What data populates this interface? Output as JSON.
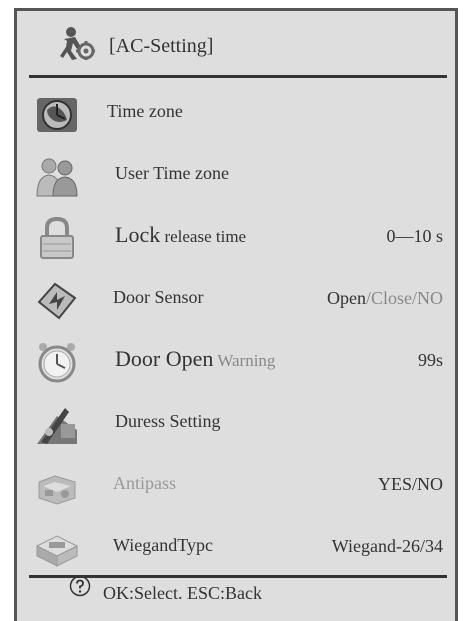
{
  "header": {
    "title": "[AC-Setting]",
    "icon": "user-settings-icon"
  },
  "menu": {
    "items": [
      {
        "label": "Time zone",
        "value": "",
        "icon": "clock-globe-icon"
      },
      {
        "label": "User Time zone",
        "value": "",
        "icon": "users-icon"
      },
      {
        "label_main": "Lock",
        "label_rest": " release time",
        "value": "0—10 s",
        "icon": "lock-icon"
      },
      {
        "label": "Door Sensor",
        "value_a": "Open",
        "value_b": "/Close/NO",
        "icon": "door-sensor-icon"
      },
      {
        "label_main": "Door Open",
        "label_rest": " Warning",
        "value": "99s",
        "icon": "alarm-clock-icon"
      },
      {
        "label": "Duress Setting",
        "value": "",
        "icon": "duress-icon"
      },
      {
        "label": "Antipass",
        "value": "YES/NO",
        "icon": "antipass-icon"
      },
      {
        "label": "WiegandTypc",
        "value": "Wiegand-26/34",
        "icon": "wiegand-icon"
      }
    ]
  },
  "footer": {
    "hint": "OK:Select. ESC:Back",
    "icon": "help-icon"
  },
  "colors": {
    "background": "#dedede",
    "text": "#333333",
    "separator": "#333333"
  }
}
